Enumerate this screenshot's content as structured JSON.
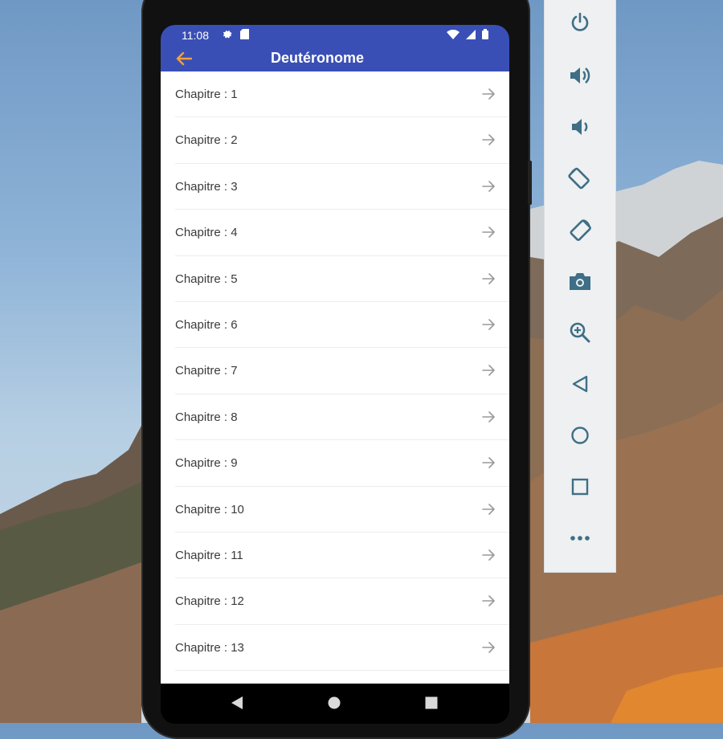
{
  "status_bar": {
    "time": "11:08",
    "icons": [
      "gear-icon",
      "sd-card-icon",
      "wifi-icon",
      "signal-icon",
      "battery-icon"
    ]
  },
  "app_bar": {
    "title": "Deutéronome",
    "back_icon": "arrow-left-icon",
    "accent_color": "#f0a13a",
    "bar_color": "#3a4fb5"
  },
  "chapters": [
    "Chapitre : 1",
    "Chapitre : 2",
    "Chapitre : 3",
    "Chapitre : 4",
    "Chapitre : 5",
    "Chapitre : 6",
    "Chapitre : 7",
    "Chapitre : 8",
    "Chapitre : 9",
    "Chapitre : 10",
    "Chapitre : 11",
    "Chapitre : 12",
    "Chapitre : 13"
  ],
  "nav_bar": [
    "back-triangle-icon",
    "home-circle-icon",
    "recents-square-icon"
  ],
  "emulator_toolbar": [
    "power-icon",
    "volume-up-icon",
    "volume-down-icon",
    "rotate-left-icon",
    "rotate-right-icon",
    "camera-icon",
    "zoom-in-icon",
    "back-icon",
    "home-icon",
    "overview-icon",
    "more-icon"
  ],
  "toolbar_icon_color": "#3e6f86"
}
